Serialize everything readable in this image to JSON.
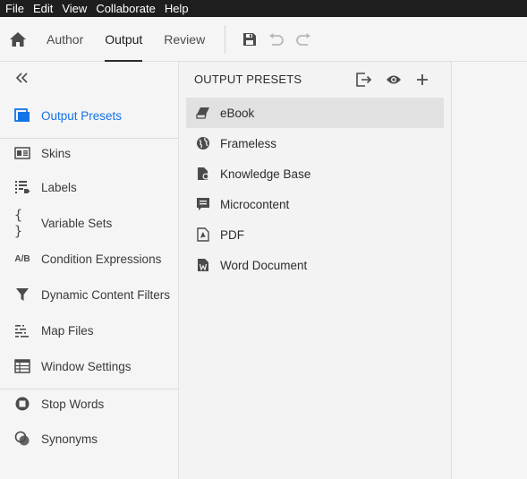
{
  "menu": [
    "File",
    "Edit",
    "View",
    "Collaborate",
    "Help"
  ],
  "toolbar": {
    "tabs": [
      "Author",
      "Output",
      "Review"
    ],
    "active_tab": "Output"
  },
  "sidebar": {
    "items": [
      {
        "label": "Output Presets",
        "icon": "output-presets-icon",
        "active": true
      },
      {
        "label": "Skins",
        "icon": "skins-icon"
      },
      {
        "label": "Labels",
        "icon": "labels-icon"
      },
      {
        "label": "Variable Sets",
        "icon": "braces-icon"
      },
      {
        "label": "Condition Expressions",
        "icon": "ab-icon",
        "icon_text": "A/B"
      },
      {
        "label": "Dynamic Content Filters",
        "icon": "filter-icon"
      },
      {
        "label": "Map Files",
        "icon": "map-files-icon"
      },
      {
        "label": "Window Settings",
        "icon": "window-settings-icon"
      },
      {
        "label": "Stop Words",
        "icon": "stop-words-icon"
      },
      {
        "label": "Synonyms",
        "icon": "synonyms-icon"
      }
    ]
  },
  "presets": {
    "heading": "OUTPUT PRESETS",
    "items": [
      {
        "label": "eBook",
        "icon": "ebook-icon",
        "selected": true
      },
      {
        "label": "Frameless",
        "icon": "globe-icon"
      },
      {
        "label": "Knowledge Base",
        "icon": "knowledge-base-icon"
      },
      {
        "label": "Microcontent",
        "icon": "microcontent-icon"
      },
      {
        "label": "PDF",
        "icon": "pdf-icon"
      },
      {
        "label": "Word Document",
        "icon": "word-document-icon"
      }
    ]
  },
  "colors": {
    "accent": "#1473e6",
    "menubar_bg": "#1e1e1e",
    "selected_bg": "#e1e1e1"
  }
}
